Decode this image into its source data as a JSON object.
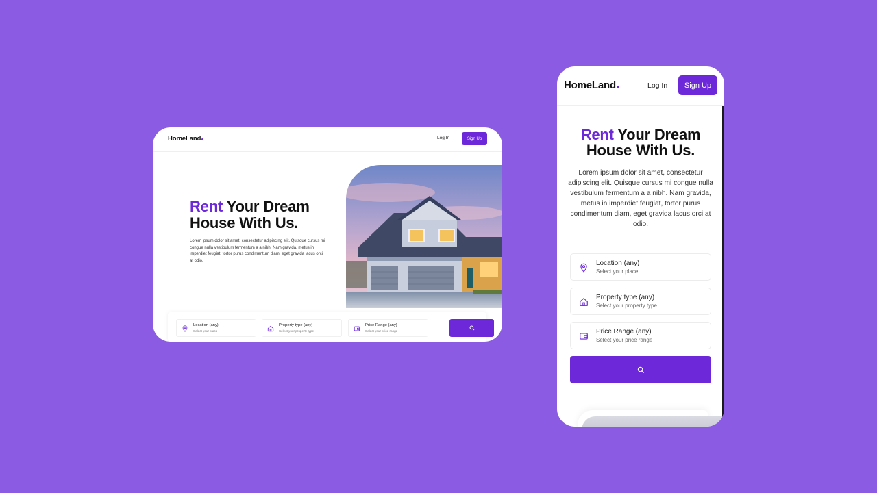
{
  "colors": {
    "background": "#8c5be3",
    "accent": "#6d28d9"
  },
  "desktop": {
    "nav": {
      "logo": "HomeLand",
      "login": "Log In",
      "signup": "Sign Up"
    },
    "hero": {
      "title_accent": "Rent",
      "title_rest": " Your Dream House With Us.",
      "body": "Lorem ipsum dolor sit amet, consectetur adipiscing elit. Quisque cursus mi congue nulla vestibulum fermentum a a nibh. Nam gravida, metus in imperdiet feugiat, tortor purus condimentum diam, eget gravida lacus orci at odio."
    },
    "search": {
      "fields": [
        {
          "icon": "location-pin-icon",
          "label": "Location (any)",
          "hint": "Select your place"
        },
        {
          "icon": "home-icon",
          "label": "Property type (any)",
          "hint": "Select your property type"
        },
        {
          "icon": "wallet-icon",
          "label": "Price Range (any)",
          "hint": "Select your price range"
        }
      ],
      "button_icon": "search-icon"
    }
  },
  "mobile": {
    "nav": {
      "logo": "HomeLand",
      "login": "Log In",
      "signup": "Sign Up"
    },
    "hero": {
      "title_accent": "Rent",
      "title_rest": " Your Dream House With Us.",
      "body": "Lorem ipsum dolor sit amet, consectetur adipiscing elit. Quisque cursus mi congue nulla vestibulum fermentum a a nibh. Nam gravida, metus in imperdiet feugiat, tortor purus condimentum diam, eget gravida lacus orci at odio."
    },
    "search": {
      "fields": [
        {
          "icon": "location-pin-icon",
          "label": "Location (any)",
          "hint": "Select your place"
        },
        {
          "icon": "home-icon",
          "label": "Property type (any)",
          "hint": "Select your property type"
        },
        {
          "icon": "wallet-icon",
          "label": "Price Range (any)",
          "hint": "Select your price range"
        }
      ],
      "button_icon": "search-icon"
    }
  }
}
